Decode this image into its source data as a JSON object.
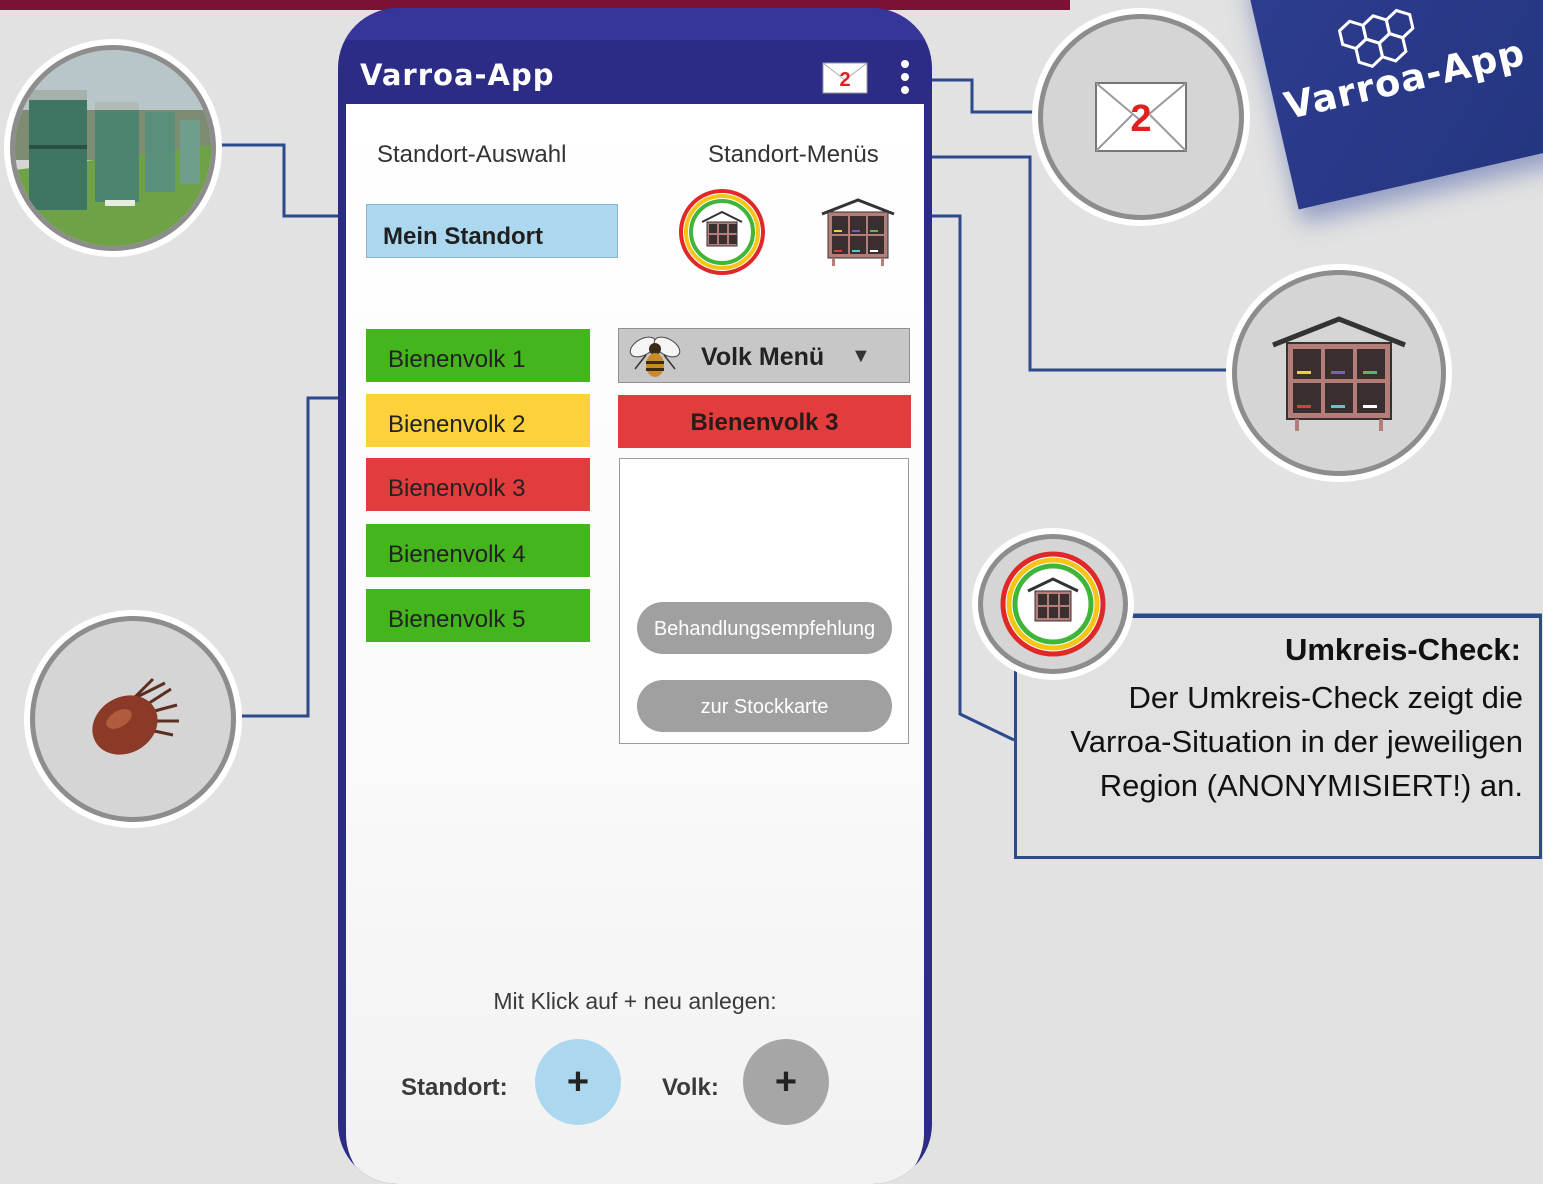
{
  "app": {
    "title": "Varroa-App",
    "mail_count": "2"
  },
  "headers": {
    "left": "Standort-Auswahl",
    "right": "Standort-Menüs"
  },
  "standort": {
    "selected": "Mein Standort"
  },
  "colonies": [
    {
      "label": "Bienenvolk 1",
      "status_color": "#45b51d"
    },
    {
      "label": "Bienenvolk 2",
      "status_color": "#fdd13a"
    },
    {
      "label": "Bienenvolk 3",
      "status_color": "#e33c3c"
    },
    {
      "label": "Bienenvolk 4",
      "status_color": "#45b51d"
    },
    {
      "label": "Bienenvolk 5",
      "status_color": "#45b51d"
    }
  ],
  "volk_menu": {
    "label": "Volk Menü",
    "arrow": "▼",
    "selected": "Bienenvolk 3",
    "actions": [
      "Behandlungsempfehlung",
      "zur Stockkarte"
    ]
  },
  "add": {
    "hint": "Mit Klick auf + neu anlegen:",
    "standort_label": "Standort:",
    "volk_label": "Volk:",
    "plus": "+",
    "standort_color": "#acd8ef",
    "volk_color": "#a6a6a6"
  },
  "callout": {
    "title": "Umkreis-Check:",
    "text": "Der Umkreis-Check zeigt die Varroa-Situation in der jeweiligen Region (ANONYMISIERT!) an."
  },
  "logo": {
    "text": "Varroa-App"
  },
  "icons": {
    "mail": "envelope-icon",
    "menu": "kebab-menu-icon",
    "umkreis": "umkreis-check-icon",
    "hive": "bee-hive-icon",
    "bee": "bee-icon",
    "mite": "varroa-mite-icon"
  }
}
